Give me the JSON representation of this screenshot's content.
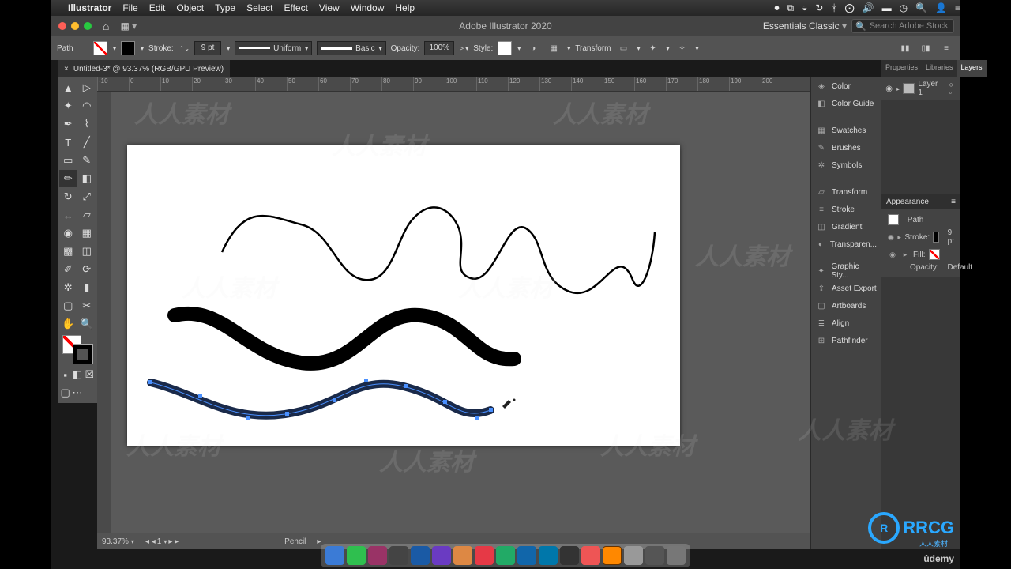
{
  "mac_menu": {
    "app": "Illustrator",
    "items": [
      "File",
      "Edit",
      "Object",
      "Type",
      "Select",
      "Effect",
      "View",
      "Window",
      "Help"
    ]
  },
  "titlebar": {
    "app_title": "Adobe Illustrator 2020",
    "workspace": "Essentials Classic",
    "search_placeholder": "Search Adobe Stock"
  },
  "controlbar": {
    "selection": "Path",
    "stroke_label": "Stroke:",
    "stroke_weight": "9 pt",
    "profile": "Uniform",
    "brush": "Basic",
    "opacity_label": "Opacity:",
    "opacity": "100%",
    "style_label": "Style:",
    "transform_label": "Transform"
  },
  "document": {
    "tab": "Untitled-3* @ 93.37% (RGB/GPU Preview)"
  },
  "ruler_ticks": [
    "-10",
    "0",
    "10",
    "20",
    "30",
    "40",
    "50",
    "60",
    "70",
    "80",
    "90",
    "100",
    "110",
    "120",
    "130",
    "140",
    "150",
    "160",
    "170",
    "180",
    "190",
    "200"
  ],
  "status": {
    "zoom": "93.37%",
    "artboard": "1",
    "tool": "Pencil"
  },
  "dock_panels": [
    "Color",
    "Color Guide",
    "Swatches",
    "Brushes",
    "Symbols",
    "Transform",
    "Stroke",
    "Gradient",
    "Transparen...",
    "Graphic Sty...",
    "Asset Export",
    "Artboards",
    "Align",
    "Pathfinder"
  ],
  "right_tabs": {
    "group1": [
      "Properties",
      "Libraries",
      "Layers"
    ],
    "active1": "Layers"
  },
  "layers": {
    "layer1": "Layer 1"
  },
  "appearance": {
    "title": "Appearance",
    "object": "Path",
    "stroke_label": "Stroke:",
    "stroke_val": "9 pt",
    "fill_label": "Fill:",
    "opacity_label": "Opacity:",
    "opacity_val": "Default"
  },
  "watermark": "人人素材",
  "branding": {
    "rcg": "RRCG",
    "sub": "人人素材",
    "udemy": "ûdemy"
  }
}
